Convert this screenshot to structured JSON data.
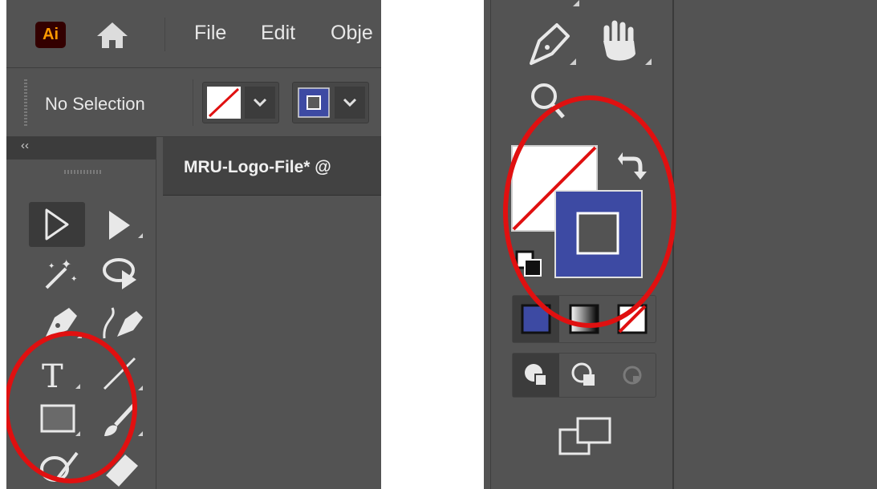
{
  "menubar": {
    "app_logo": "Ai",
    "items": [
      "File",
      "Edit",
      "Obje"
    ]
  },
  "control_bar": {
    "selection_label": "No Selection",
    "fill_swatch": "none",
    "stroke_swatch": "#3d4aa3"
  },
  "tool_panel": {
    "collapse_label": "‹‹",
    "tools": [
      "selection",
      "direct-selection",
      "magic-wand",
      "lasso",
      "pen",
      "curvature",
      "type",
      "line-segment",
      "rectangle",
      "paintbrush",
      "shaper",
      "eraser"
    ]
  },
  "document_tab": {
    "title": "MRU-Logo-File* @"
  },
  "right_panel": {
    "tools": [
      "pen",
      "hand",
      "zoom"
    ],
    "fill": "none",
    "stroke": "#3d4aa3",
    "color_modes": [
      "color",
      "gradient",
      "none"
    ],
    "draw_modes": [
      "draw-normal",
      "draw-behind",
      "draw-inside"
    ],
    "screen_mode": "change-screen-mode"
  },
  "colors": {
    "panel_bg": "#535353",
    "accent_blue": "#3d4aa3",
    "annotation_red": "#e01010"
  }
}
